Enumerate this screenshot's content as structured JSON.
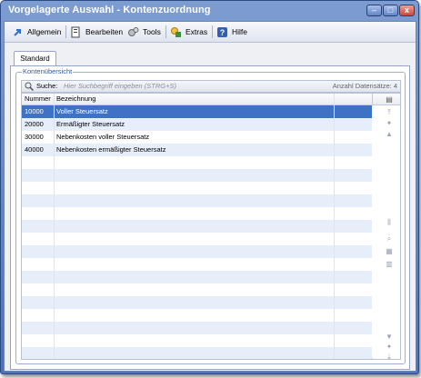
{
  "window": {
    "title": "Vorgelagerte Auswahl - Kontenzuordnung",
    "min": "–",
    "max": "□",
    "close": "x"
  },
  "menu": [
    {
      "label": "Allgemein",
      "icon": "arrow-icon",
      "color": "#2f6fd1"
    },
    {
      "label": "Bearbeiten",
      "icon": "edit-icon",
      "color": "#3b3b3b"
    },
    {
      "label": "Tools",
      "icon": "gears-icon",
      "color": "#777777"
    },
    {
      "label": "Extras",
      "icon": "extras-icon",
      "color": "#e2a81b"
    },
    {
      "label": "Hilfe",
      "icon": "help-icon",
      "color": "#2f5fb8"
    }
  ],
  "tab": {
    "label": "Standard"
  },
  "group": {
    "legend": "Kontenübersicht"
  },
  "search": {
    "label": "Suche:",
    "placeholder": "Hier Suchbegriff eingeben (STRG+S)",
    "count_label": "Anzahl Datensätze: 4"
  },
  "table": {
    "columns": [
      "Nummer",
      "Bezeichnung"
    ],
    "rows": [
      {
        "nummer": "10000",
        "bezeichnung": "Voller Steuersatz",
        "selected": true
      },
      {
        "nummer": "20000",
        "bezeichnung": "Ermäßigter Steuersatz",
        "selected": false
      },
      {
        "nummer": "30000",
        "bezeichnung": "Nebenkosten voller Steuersatz",
        "selected": false
      },
      {
        "nummer": "40000",
        "bezeichnung": "Nebenkosten ermäßigter Steuersatz",
        "selected": false
      }
    ]
  },
  "colors": {
    "selection": "#3f71c4",
    "alt_row": "#e6eefa",
    "title_bar": "#5a7ec0"
  }
}
